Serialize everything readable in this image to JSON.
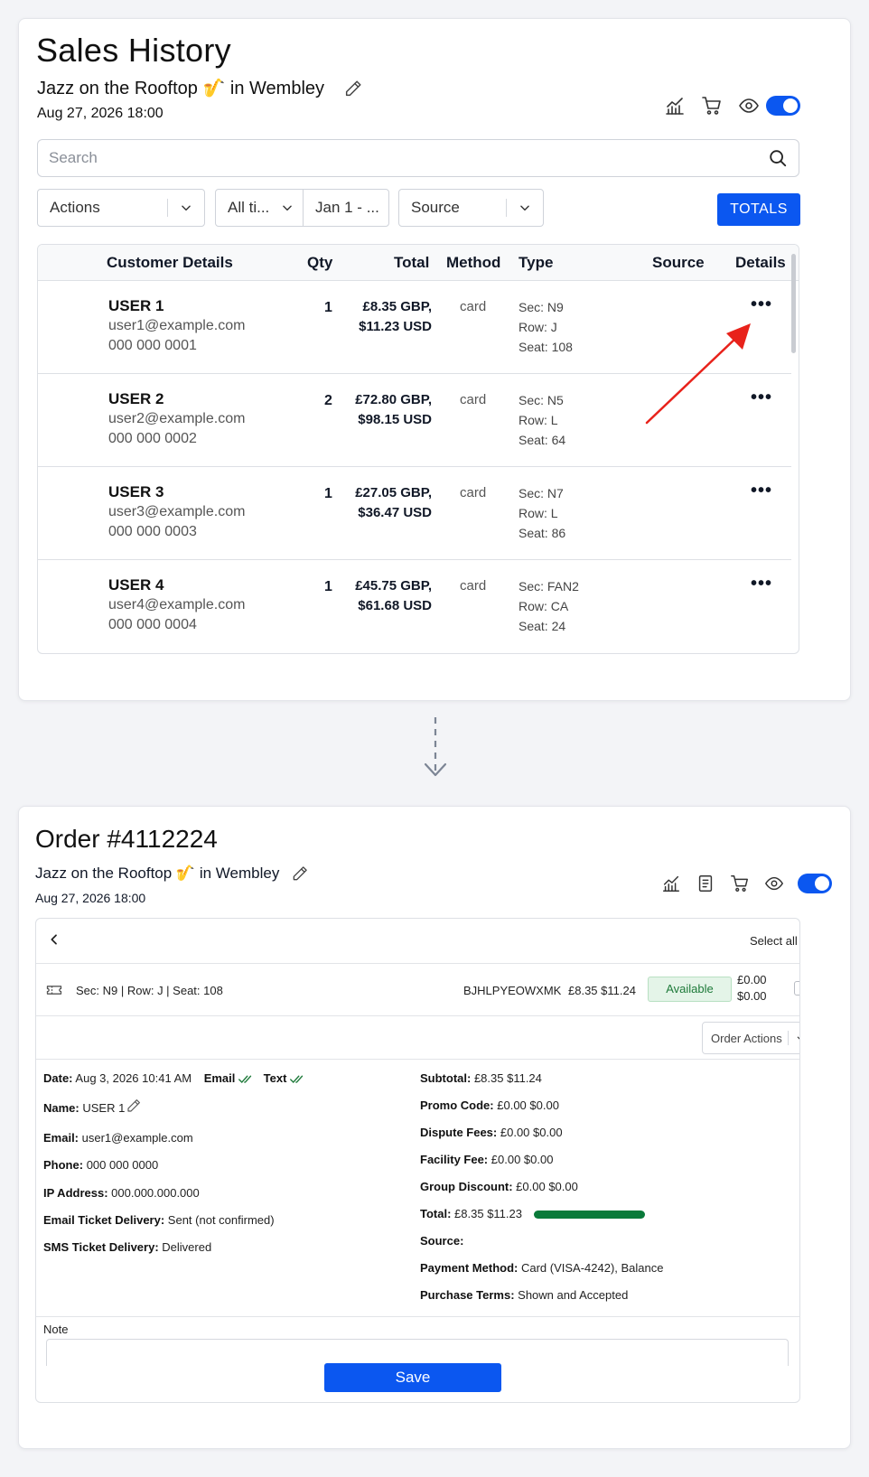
{
  "sales_history": {
    "title": "Sales History",
    "event_name": "Jazz on the Rooftop 🎷 in Wembley",
    "event_date": "Aug 27, 2026 18:00",
    "search_placeholder": "Search",
    "filters": {
      "actions_label": "Actions",
      "time_label": "All ti...",
      "date_range_label": "Jan 1 - ...",
      "source_label": "Source"
    },
    "totals_label": "TOTALS",
    "columns": [
      "Customer Details",
      "Qty",
      "Total",
      "Method",
      "Type",
      "Source",
      "Details"
    ],
    "rows": [
      {
        "name": "USER 1",
        "email": "user1@example.com",
        "phone": "000 000 0001",
        "qty": "1",
        "total_gbp": "£8.35 GBP,",
        "total_usd": "$11.23 USD",
        "method": "card",
        "sec": "Sec: N9",
        "row": "Row: J",
        "seat": "Seat: 108",
        "details": "•••"
      },
      {
        "name": "USER 2",
        "email": "user2@example.com",
        "phone": "000 000 0002",
        "qty": "2",
        "total_gbp": "£72.80 GBP,",
        "total_usd": "$98.15 USD",
        "method": "card",
        "sec": "Sec: N5",
        "row": "Row: L",
        "seat": "Seat: 64",
        "details": "•••"
      },
      {
        "name": "USER 3",
        "email": "user3@example.com",
        "phone": "000 000 0003",
        "qty": "1",
        "total_gbp": "£27.05 GBP,",
        "total_usd": "$36.47 USD",
        "method": "card",
        "sec": "Sec: N7",
        "row": "Row: L",
        "seat": "Seat: 86",
        "details": "•••"
      },
      {
        "name": "USER 4",
        "email": "user4@example.com",
        "phone": "000 000 0004",
        "qty": "1",
        "total_gbp": "£45.75 GBP,",
        "total_usd": "$61.68 USD",
        "method": "card",
        "sec": "Sec: FAN2",
        "row": "Row: CA",
        "seat": "Seat: 24",
        "details": "•••"
      }
    ],
    "annotation_color": "#e8221b"
  },
  "order": {
    "title": "Order #4112224",
    "event_name": "Jazz on the Rooftop 🎷 in Wembley",
    "event_date": "Aug 27, 2026 18:00",
    "select_all_label": "Select all",
    "ticket": {
      "seat_info": "Sec: N9 | Row: J | Seat: 108",
      "code": "BJHLPYEOWXMK",
      "price": "£8.35 $11.24",
      "status": "Available",
      "fee_gbp": "£0.00",
      "fee_usd": "$0.00"
    },
    "order_actions_label": "Order Actions",
    "left_details": {
      "date_label": "Date:",
      "date_value": "Aug 3, 2026 10:41 AM",
      "email_flag": "Email",
      "text_flag": "Text",
      "name_label": "Name:",
      "name_value": "USER 1",
      "email_label": "Email:",
      "email_value": "user1@example.com",
      "phone_label": "Phone:",
      "phone_value": "000 000 0000",
      "ip_label": "IP Address:",
      "ip_value": "000.000.000.000",
      "email_delivery_label": "Email Ticket Delivery:",
      "email_delivery_value": "Sent (not confirmed)",
      "sms_delivery_label": "SMS Ticket Delivery:",
      "sms_delivery_value": "Delivered"
    },
    "right_details": {
      "subtotal_label": "Subtotal:",
      "subtotal_value": "£8.35 $11.24",
      "promo_label": "Promo Code:",
      "promo_value": "£0.00 $0.00",
      "dispute_label": "Dispute Fees:",
      "dispute_value": "£0.00 $0.00",
      "facility_label": "Facility Fee:",
      "facility_value": "£0.00 $0.00",
      "group_label": "Group Discount:",
      "group_value": "£0.00 $0.00",
      "total_label": "Total:",
      "total_value": "£8.35 $11.23",
      "source_label": "Source:",
      "payment_label": "Payment Method:",
      "payment_value": "Card (VISA-4242), Balance",
      "terms_label": "Purchase Terms:",
      "terms_value": "Shown and Accepted"
    },
    "note_label": "Note",
    "save_label": "Save"
  },
  "colors": {
    "accent": "#0b57f0",
    "available_green": "#1e7a3a",
    "total_bar": "#0a7a3a"
  }
}
